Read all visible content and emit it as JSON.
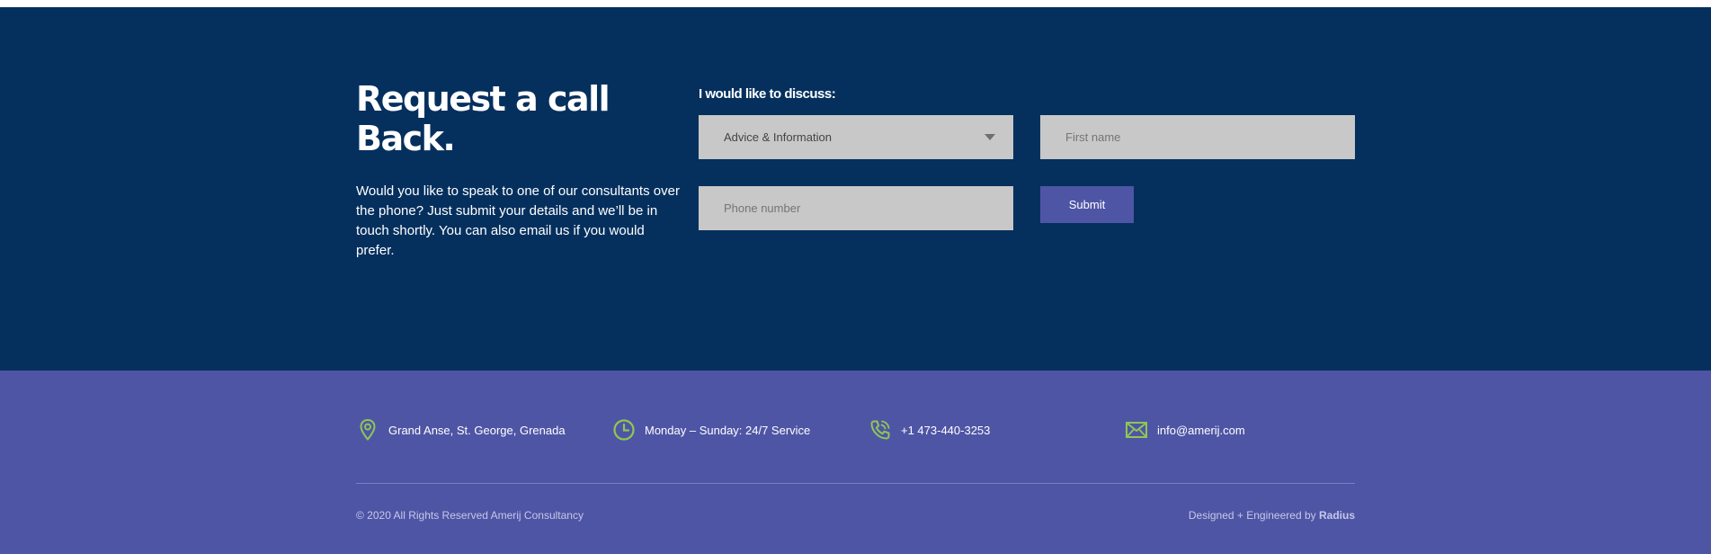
{
  "callback": {
    "heading": "Request a call Back.",
    "intro": "Would you like to speak to one of our consultants over the phone? Just submit your details and we’ll be in touch shortly. You can also email us if you would prefer.",
    "form_label": "I would like to discuss:",
    "topic_select": {
      "value": "Advice & Information"
    },
    "first_name": {
      "placeholder": "First name"
    },
    "phone": {
      "placeholder": "Phone number"
    },
    "submit_label": "Submit"
  },
  "footer": {
    "contacts": [
      {
        "icon": "map-pin-icon",
        "text": "Grand Anse, St. George, Grenada"
      },
      {
        "icon": "clock-icon",
        "text": "Monday – Sunday: 24/7 Service"
      },
      {
        "icon": "phone-icon",
        "text": "+1 473-440-3253"
      },
      {
        "icon": "mail-icon",
        "text": "info@amerij.com"
      }
    ],
    "copyright": "© 2020 All Rights Reserved Amerij Consultancy",
    "credits_prefix": "Designed + Engineered by",
    "credits_brand": "Radius"
  },
  "colors": {
    "callback_bg": "#05305e",
    "footer_bg": "#4f55a5",
    "icon_accent": "#8fc655",
    "field_bg": "#c8c8c8"
  }
}
